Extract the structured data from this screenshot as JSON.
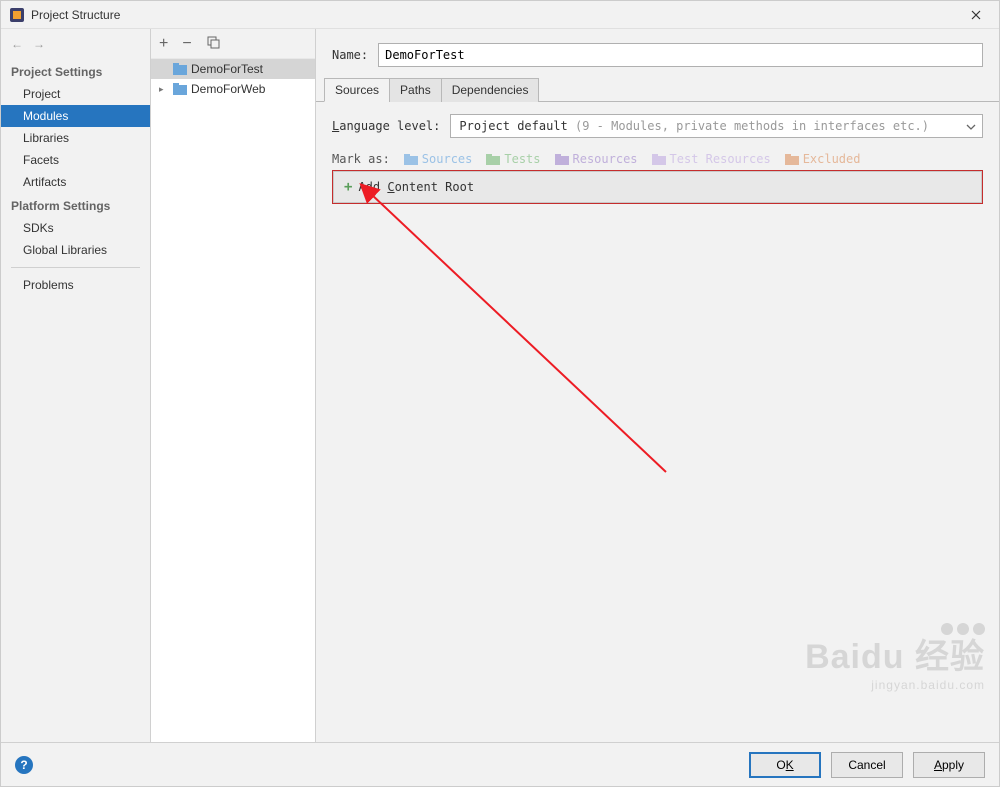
{
  "window": {
    "title": "Project Structure"
  },
  "nav": {
    "project_settings_header": "Project Settings",
    "project": "Project",
    "modules": "Modules",
    "libraries": "Libraries",
    "facets": "Facets",
    "artifacts": "Artifacts",
    "platform_settings_header": "Platform Settings",
    "sdks": "SDKs",
    "global_libraries": "Global Libraries",
    "problems": "Problems"
  },
  "tree": {
    "items": [
      {
        "label": "DemoForTest",
        "selected": true,
        "expandable": false
      },
      {
        "label": "DemoForWeb",
        "selected": false,
        "expandable": true
      }
    ]
  },
  "content": {
    "name_label": "Name:",
    "name_value": "DemoForTest",
    "tabs": {
      "sources": "Sources",
      "paths": "Paths",
      "dependencies": "Dependencies"
    },
    "language_level_label": "Language level:",
    "language_level_value": "Project default",
    "language_level_hint": "(9 - Modules, private methods in interfaces etc.)",
    "mark_as_label": "Mark as:",
    "marks": {
      "sources": "Sources",
      "tests": "Tests",
      "resources": "Resources",
      "test_resources": "Test Resources",
      "excluded": "Excluded"
    },
    "add_content_root": "Add Content Root"
  },
  "buttons": {
    "ok": "OK",
    "cancel": "Cancel",
    "apply": "Apply"
  },
  "colors": {
    "selection": "#2675BF",
    "mark_sources": "#4a8ad0",
    "mark_tests": "#58a458",
    "mark_resources": "#8a6bbf",
    "mark_test_resources": "#b59fd6",
    "mark_excluded": "#d48a58",
    "annotation": "#ed1c24"
  },
  "watermark": {
    "brand": "Baidu 经验",
    "url": "jingyan.baidu.com"
  }
}
